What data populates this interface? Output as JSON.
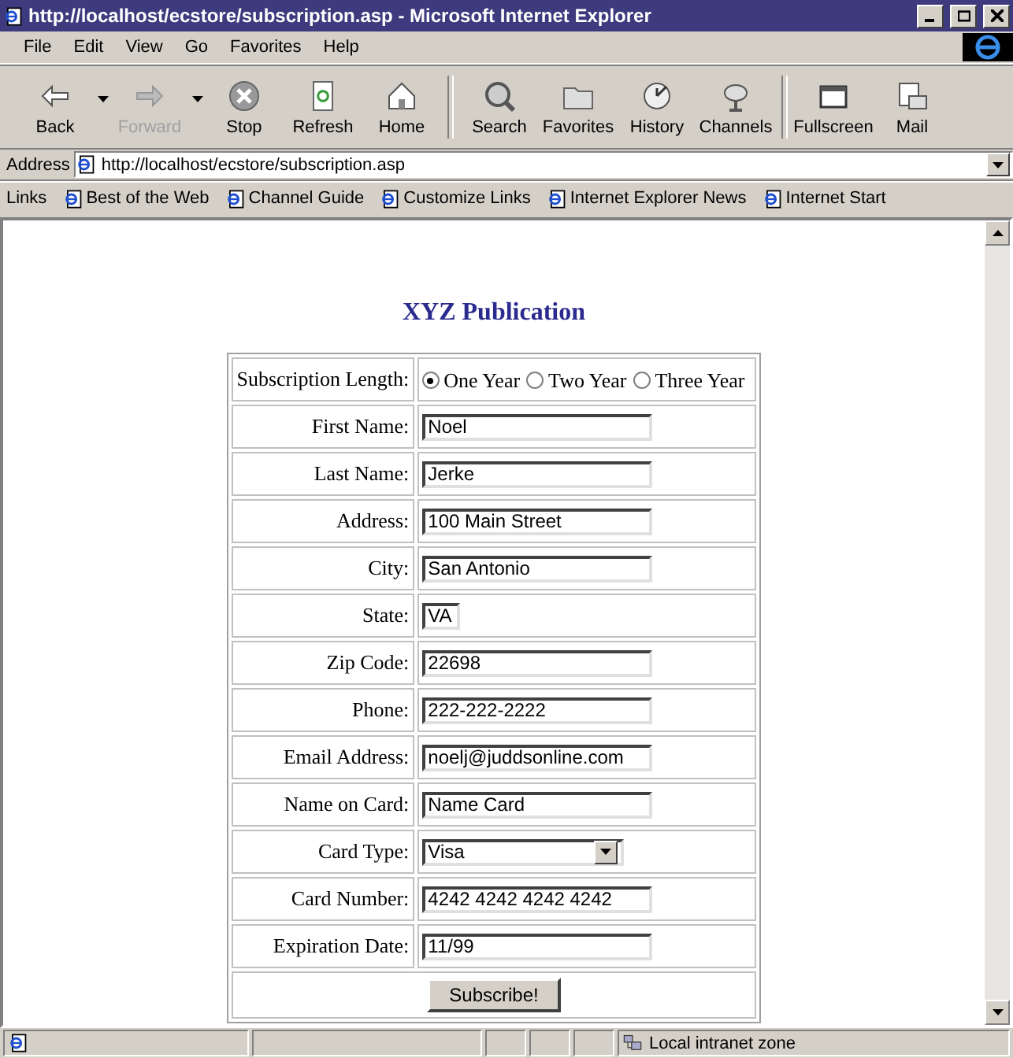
{
  "window": {
    "title": "http://localhost/ecstore/subscription.asp - Microsoft Internet Explorer"
  },
  "menu": [
    "File",
    "Edit",
    "View",
    "Go",
    "Favorites",
    "Help"
  ],
  "toolbar": [
    {
      "buttons": [
        {
          "label": "Back",
          "dropdown": true,
          "disabled": false
        },
        {
          "label": "Forward",
          "dropdown": true,
          "disabled": true
        },
        {
          "label": "Stop",
          "dropdown": false,
          "disabled": false
        },
        {
          "label": "Refresh",
          "dropdown": false,
          "disabled": false
        },
        {
          "label": "Home",
          "dropdown": false,
          "disabled": false
        }
      ]
    },
    {
      "buttons": [
        {
          "label": "Search",
          "dropdown": false,
          "disabled": false
        },
        {
          "label": "Favorites",
          "dropdown": false,
          "disabled": false
        },
        {
          "label": "History",
          "dropdown": false,
          "disabled": false
        },
        {
          "label": "Channels",
          "dropdown": false,
          "disabled": false
        }
      ]
    },
    {
      "buttons": [
        {
          "label": "Fullscreen",
          "dropdown": false,
          "disabled": false
        },
        {
          "label": "Mail",
          "dropdown": false,
          "disabled": false
        }
      ]
    }
  ],
  "address": {
    "label": "Address",
    "value": "http://localhost/ecstore/subscription.asp"
  },
  "links": {
    "label": "Links",
    "items": [
      "Best of the Web",
      "Channel Guide",
      "Customize Links",
      "Internet Explorer News",
      "Internet Start"
    ]
  },
  "page": {
    "heading": "XYZ Publication",
    "rows": [
      {
        "kind": "radio",
        "label": "Subscription Length:",
        "options": [
          {
            "label": "One Year",
            "selected": true
          },
          {
            "label": "Two Year",
            "selected": false
          },
          {
            "label": "Three Year",
            "selected": false
          }
        ]
      },
      {
        "kind": "text",
        "label": "First Name:",
        "value": "Noel"
      },
      {
        "kind": "text",
        "label": "Last Name:",
        "value": "Jerke"
      },
      {
        "kind": "text",
        "label": "Address:",
        "value": "100 Main Street"
      },
      {
        "kind": "text",
        "label": "City:",
        "value": "San Antonio"
      },
      {
        "kind": "short",
        "label": "State:",
        "value": "VA"
      },
      {
        "kind": "text",
        "label": "Zip Code:",
        "value": "22698"
      },
      {
        "kind": "text",
        "label": "Phone:",
        "value": "222-222-2222"
      },
      {
        "kind": "text",
        "label": "Email Address:",
        "value": "noelj@juddsonline.com"
      },
      {
        "kind": "text",
        "label": "Name on Card:",
        "value": "Name Card"
      },
      {
        "kind": "select",
        "label": "Card Type:",
        "value": "Visa"
      },
      {
        "kind": "text",
        "label": "Card Number:",
        "value": "4242 4242 4242 4242"
      },
      {
        "kind": "text",
        "label": "Expiration Date:",
        "value": "11/99"
      },
      {
        "kind": "button",
        "label": "Subscribe!"
      }
    ]
  },
  "status_bar": {
    "zone": "Local intranet zone"
  }
}
